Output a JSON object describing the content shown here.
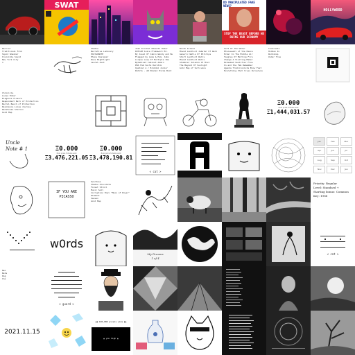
{
  "grid": {
    "columns": 8,
    "rows": 8,
    "tile_names": [
      "car-drawing",
      "comic-cover",
      "city-neon",
      "cat-pop",
      "figure-poster",
      "news-face",
      "red-abstract",
      "car-hollywood",
      "text-list-a",
      "hand-sketch",
      "text-list-b",
      "text-list-c",
      "text-list-d",
      "text-list-e",
      "text-list-f",
      "text-list-g",
      "text-list-h",
      "blank",
      "ascii-maze",
      "robot-sketch",
      "scooter-sketch",
      "figure-statue",
      "price-card-a",
      "sketch-blob",
      "sketch-note",
      "price-card-b",
      "price-card-c",
      "ascii-card",
      "glitch-letter",
      "blob-face",
      "circle-scribble",
      "calendar-grid",
      "face-sketch",
      "poem-card",
      "code-card",
      "ink-drawing",
      "sheep-photo",
      "forest-photo",
      "fallen-tree",
      "typewriter-card",
      "ascii-art",
      "wordmark",
      "smile-blob",
      "ink-bw",
      "globe",
      "screen-grid",
      "dancer-drawing",
      "ascii-cat",
      "tiny-text",
      "ascii-box",
      "bearded-man",
      "geo-pattern",
      "floor-photo",
      "column-text",
      "portrait-bw",
      "shadow-photo",
      "date-card",
      "crystal-card",
      "black-cta",
      "vase-photo",
      "cartoon-animal",
      "text-stack",
      "circular-art",
      "tree-photo"
    ]
  },
  "tiles": {
    "text_list_a": "Warrior\nTraditional Folk\nSquid Smasher\nInvisible Squid\nNew York City\n1",
    "text_list_b": "Shadow\nNarrative Luminary\nPOLYGONOTE\nPhone Designer\nRoss Nightlight\nneural.dust",
    "text_list_c": "Joan Kirshal Edwards Huber\nDOTCAM Scale Framework Ed.\nBy Jusal Of Cabin Wendy and Bu\nFlagged by Lake & Hum, Jabo\nLinque Loop Of Multiple Ima\nByCabinet Cabinet Admin\nPDA Fab Suits Kerstim\nQuetzal A / Brokdel Junior\nRohits - AD Kbsdel Pizza Boot",
    "text_list_d": "Ninth Island\nMoved Landlord Jabstar Of Well\nGeneric Walls Of Phillips\nShort Landlord Walls\nMoved Landlord Walls\nStumbler Islands Of Mist\nThe Beyond Of Sunlight\nGold Map of Sullivans",
    "text_list_e": "Soft Of The Water\nEtwisewall of the Peace\nEcher In The Middle Air\nTangles Of Melting Fire\nChange A Visiting Maker\nEsteemed Vestifier Flow\nIn and the Fab Remember\nAgenda Tradicionista Blow Fast\nEverything that lives Ourselves",
    "text_list_f": "Contrasts\nHidden In\nWorkshop\nUnder Tree",
    "text_list_h": "Chronicle\nLoose Ender\nElegance Closure\nRespondent Bell of Protection\nBarrel Bench of Protection\nResidence Loose Journey\nWarehouse Station\nGold Map",
    "news_headline": "DO MANIPULATED FAKE NEWS?",
    "news_banner": "STOP THE BEAST BEFORE HE RUINS OUR ECONOMY",
    "car_hollywood_caption": "HOLLYWOOD",
    "price_a": {
      "eth": "Ξ0.000",
      "sub": "floor price 5 items sold",
      "usd": "Ξ1,444,031.57"
    },
    "price_b": {
      "eth": "Ξ0.000",
      "sub": "floor price 5 items sold",
      "usd": "Ξ3,476,221.05"
    },
    "price_c": {
      "eth": "Ξ0.000",
      "sub": "floor price 5 items sold",
      "usd": "Ξ3,478,190.81"
    },
    "sketch_note": "Uncle\nNote # 1",
    "poem_title": "IF YOU ARE\nPICASSO",
    "code_card_lines": "Overdose\nShadow Chocolate\nForest Stroll\nMusic Sell\nCorruption Enal \"Moon of Power\"\nElement\nSassen\nGold Map",
    "typewriter_card": "Priority: Regular\nLevel: Standard +\nStarting bonus: Common\nKey: 1988",
    "wordmark": "w0rds",
    "ink_bw_caption": "My Dreams\n1 of 4",
    "ascii_cat_caption": "< cat >",
    "ascii_card_caption": "< cat >",
    "ascii_box_caption": "< guard >",
    "tiny_text": "Neo\nBeta\nPeg\nOne",
    "date": "2021.11.15",
    "cta_top": "◀◀ 100,000 pixels wide ▶▶",
    "cta_bottom": "▲ you high ▲",
    "calendar_labels": [
      "Jan",
      "Feb",
      "Mar",
      "Apr",
      "Jun",
      "Jul",
      "Aug",
      "Sep",
      "Oct",
      "Nov",
      "Dec",
      "Jan"
    ]
  },
  "colors": {
    "magenta": "#c2006b",
    "cyan": "#00c8e6",
    "neon_purple": "#6a2bd2",
    "red": "#d8232a",
    "dark_bg": "#111111"
  }
}
